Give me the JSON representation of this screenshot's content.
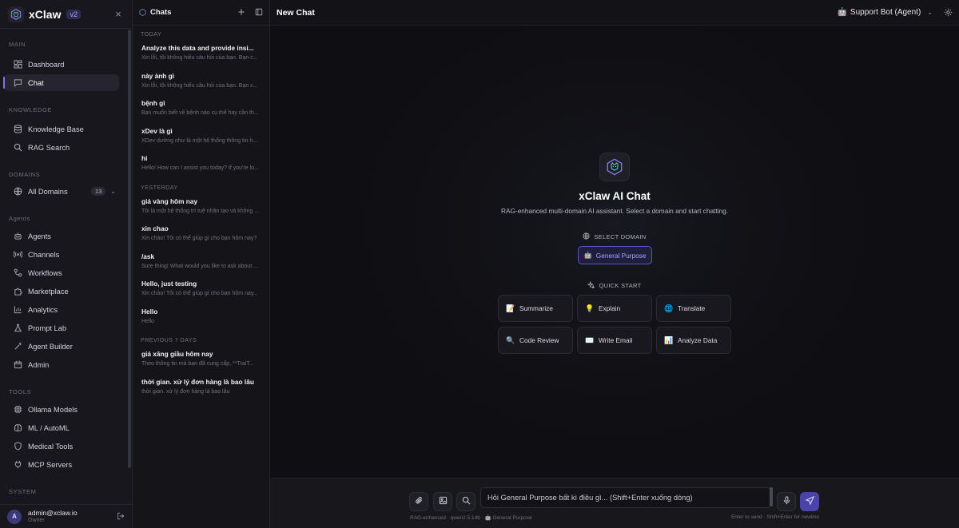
{
  "brand": {
    "name": "xClaw",
    "badge": "v2",
    "close": "×"
  },
  "sidebar": {
    "sections": {
      "main": "MAIN",
      "knowledge": "KNOWLEDGE",
      "domains": "DOMAINS",
      "agents": "Agents",
      "tools": "TOOLS",
      "system": "SYSTEM"
    },
    "items": [
      {
        "label": "Dashboard",
        "icon": "dashboard-icon"
      },
      {
        "label": "Chat",
        "icon": "chat-icon",
        "active": true
      },
      {
        "label": "Knowledge Base",
        "icon": "database-icon"
      },
      {
        "label": "RAG Search",
        "icon": "search-icon"
      },
      {
        "label": "All Domains",
        "icon": "globe-icon",
        "count": "13"
      },
      {
        "label": "Agents",
        "icon": "bot-icon"
      },
      {
        "label": "Channels",
        "icon": "broadcast-icon"
      },
      {
        "label": "Workflows",
        "icon": "workflow-icon"
      },
      {
        "label": "Marketplace",
        "icon": "puzzle-icon"
      },
      {
        "label": "Analytics",
        "icon": "bar-chart-icon"
      },
      {
        "label": "Prompt Lab",
        "icon": "flask-icon"
      },
      {
        "label": "Agent Builder",
        "icon": "wand-icon"
      },
      {
        "label": "Admin",
        "icon": "calendar-icon"
      },
      {
        "label": "Ollama Models",
        "icon": "cpu-icon"
      },
      {
        "label": "ML / AutoML",
        "icon": "brain-icon"
      },
      {
        "label": "Medical Tools",
        "icon": "shield-icon"
      },
      {
        "label": "MCP Servers",
        "icon": "plug-icon"
      }
    ],
    "user": {
      "initial": "A",
      "email": "admin@xclaw.io",
      "role": "Owner"
    }
  },
  "chats": {
    "title": "Chats",
    "groups": {
      "today": "TODAY",
      "yesterday": "YESTERDAY",
      "previous": "PREVIOUS 7 DAYS"
    },
    "items": [
      {
        "title": "Analyze this data and provide insi...",
        "preview": "Xin lỗi, tôi không hiểu câu hỏi của bạn. Bạn c..."
      },
      {
        "title": "này ảnh gì",
        "preview": "Xin lỗi, tôi không hiểu câu hỏi của bạn. Bạn c..."
      },
      {
        "title": "bệnh gì",
        "preview": "Bạn muốn biết về bệnh nào cụ thể hay cần th..."
      },
      {
        "title": "xDev là gì",
        "preview": "XDev dường như là một hệ thống thông tin h..."
      },
      {
        "title": "hi",
        "preview": "Hello! How can I assist you today? If you're lo..."
      },
      {
        "title": "giá vàng hôm nay",
        "preview": "Tôi là một hệ thống trí tuệ nhân tạo và không ..."
      },
      {
        "title": "xin chao",
        "preview": "Xin chào! Tôi có thể giúp gì cho bạn hôm nay?"
      },
      {
        "title": "/ask",
        "preview": "Sure thing! What would you like to ask about ..."
      },
      {
        "title": "Hello, just testing",
        "preview": "Xin chào! Tôi có thể giúp gì cho bạn hôm nay..."
      },
      {
        "title": "Hello",
        "preview": "Hello"
      },
      {
        "title": "giá xăng giầu hôm nay",
        "preview": "Theo thông tin mà bạn đã cung cấp, **TraiT..."
      },
      {
        "title": "thời gian. xử lý đơn hàng là bao lâu",
        "preview": "thời gian. xử lý đơn hàng là bao lâu"
      }
    ]
  },
  "main": {
    "title": "New Chat",
    "bot": {
      "icon": "🤖",
      "label": "Support Bot (Agent)"
    },
    "hero": {
      "title": "xClaw AI Chat",
      "subtitle": "RAG-enhanced multi-domain AI assistant. Select a domain and start chatting."
    },
    "select_domain": "SELECT DOMAIN",
    "domain": {
      "icon": "🤖",
      "label": "General Purpose"
    },
    "quick_start": "QUICK START",
    "quick": [
      {
        "icon": "📝",
        "label": "Summarize"
      },
      {
        "icon": "💡",
        "label": "Explain"
      },
      {
        "icon": "🌐",
        "label": "Translate"
      },
      {
        "icon": "🔍",
        "label": "Code Review"
      },
      {
        "icon": "✉️",
        "label": "Write Email"
      },
      {
        "icon": "📊",
        "label": "Analyze Data"
      }
    ],
    "composer": {
      "placeholder": "Hỏi General Purpose bất kì điều gì... (Shift+Enter xuống dòng)",
      "footer_left": "RAG-enhanced · qwen2.5:14b · 🤖 General Purpose",
      "footer_right": "Enter to send · Shift+Enter for newline"
    }
  },
  "colors": {
    "accent": "#7d74f0",
    "bg": "#0f0f13",
    "sidebar": "#17171d",
    "send": "#4b44a8"
  }
}
